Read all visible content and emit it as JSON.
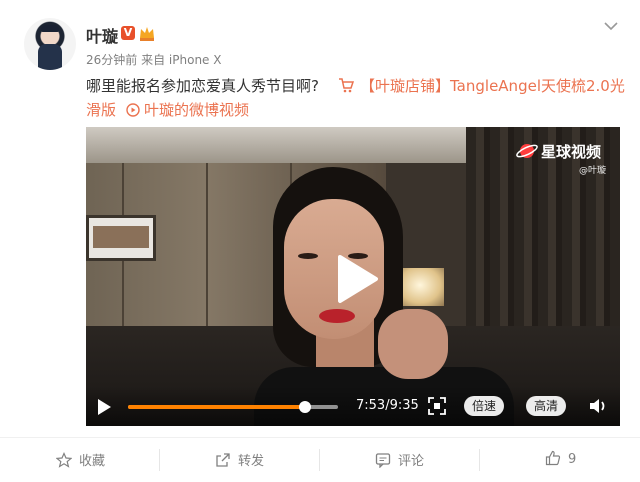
{
  "post": {
    "author": "叶璇",
    "verified_badge": "V",
    "timestamp": "26分钟前",
    "source": "来自 iPhone X",
    "text": "哪里能报名参加恋爱真人秀节目啊?",
    "shop_link": "【叶璇店铺】TangleAngel天使梳2.0光",
    "shop_link_cont": "滑版",
    "video_link": "叶璇的微博视频"
  },
  "video": {
    "logo": "星球视频",
    "logo_sub": "@叶璇",
    "current_time": "7:53",
    "total_time": "9:35",
    "time_display": "7:53/9:35",
    "progress": 0.8418,
    "speed_label": "倍速",
    "quality_label": "高清"
  },
  "actions": {
    "favorite": "收藏",
    "repost": "转发",
    "comment": "评论",
    "like_count": "9"
  },
  "colors": {
    "link": "#eb7350",
    "progress": "#ff8200",
    "verified": "#e8502a",
    "muted": "#808080"
  }
}
